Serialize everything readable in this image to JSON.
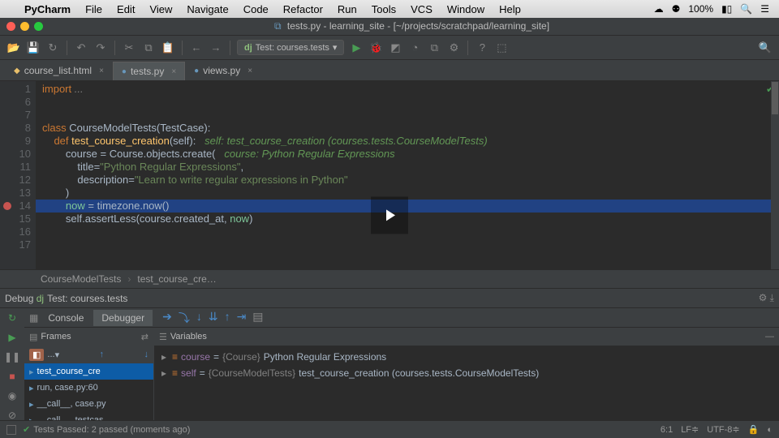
{
  "menubar": {
    "items": [
      "PyCharm",
      "File",
      "Edit",
      "View",
      "Navigate",
      "Code",
      "Refactor",
      "Run",
      "Tools",
      "VCS",
      "Window",
      "Help"
    ],
    "battery": "100%"
  },
  "window": {
    "title": "tests.py - learning_site - [~/projects/scratchpad/learning_site]"
  },
  "toolbar": {
    "run_config": "Test: courses.tests"
  },
  "tabs": [
    {
      "label": "course_list.html",
      "active": false,
      "icon": "html"
    },
    {
      "label": "tests.py",
      "active": true,
      "icon": "py"
    },
    {
      "label": "views.py",
      "active": false,
      "icon": "py"
    }
  ],
  "editor": {
    "lines": [
      "1",
      "6",
      "7",
      "8",
      "9",
      "10",
      "11",
      "12",
      "13",
      "14",
      "15",
      "16",
      "17"
    ],
    "breakpoint_line": "14",
    "code": {
      "l1": {
        "pre": "import ",
        "rest": "..."
      },
      "l8": {
        "kw": "class ",
        "name": "CourseModelTests",
        "rest": "(TestCase):"
      },
      "l9": {
        "kw": "    def ",
        "fn": "test_course_creation",
        "args": "(self):",
        "hint": "   self: test_course_creation (courses.tests.CourseModelTests)"
      },
      "l10": {
        "pre": "        course = Course.objects.create(",
        "hint": "   course: Python Regular Expressions"
      },
      "l11": {
        "pre": "            title=",
        "str": "\"Python Regular Expressions\"",
        "post": ","
      },
      "l12": {
        "pre": "            description=",
        "str": "\"Learn to write regular expressions in Python\""
      },
      "l13": {
        "pre": "        )"
      },
      "l14": {
        "pre": "        ",
        "var": "now",
        "rest": " = timezone.now()"
      },
      "l15": {
        "pre": "        self.assertLess(course.created_at, ",
        "var": "now",
        "post": ")"
      }
    }
  },
  "breadcrumb": {
    "class": "CourseModelTests",
    "method": "test_course_cre…"
  },
  "debug": {
    "title": "Debug",
    "config": "Test: courses.tests",
    "tabs": [
      "Console",
      "Debugger"
    ],
    "frames_label": "Frames",
    "vars_label": "Variables",
    "thread": "...",
    "frames": [
      {
        "label": "test_course_cre",
        "sel": true
      },
      {
        "label": "run, case.py:60"
      },
      {
        "label": "__call__, case.py"
      },
      {
        "label": "__call__, testcas"
      }
    ],
    "vars": [
      {
        "name": "course",
        "type": "{Course}",
        "value": "Python Regular Expressions"
      },
      {
        "name": "self",
        "type": "{CourseModelTests}",
        "value": "test_course_creation (courses.tests.CourseModelTests)"
      }
    ]
  },
  "status": {
    "tests": "Tests Passed: 2 passed (moments ago)",
    "pos": "6:1",
    "le": "LF",
    "enc": "UTF-8"
  }
}
